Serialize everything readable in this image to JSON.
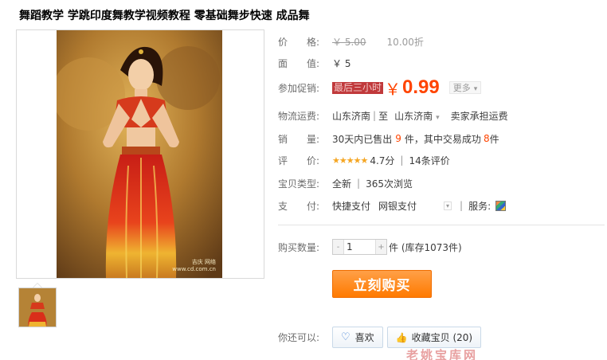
{
  "title": "舞蹈教学 学跳印度舞教学视频教程 零基础舞步快速 成品舞",
  "image": {
    "watermark_line1": "吉庆 网络",
    "watermark_line2": "www.cd.com.cn"
  },
  "price": {
    "label": "价　　格:",
    "original": "￥ 5.00",
    "discount": "10.00折"
  },
  "face_value": {
    "label": "面　　值:",
    "value": "￥ 5"
  },
  "promo": {
    "label": "参加促销:",
    "tag": "最后三小时",
    "currency": "￥",
    "price": "0.99",
    "more": "更多"
  },
  "shipping": {
    "label": "物流运费:",
    "from": "山东济南",
    "to_word": "至",
    "to": "山东济南",
    "fee": "卖家承担运费"
  },
  "sales": {
    "label": "销　　量:",
    "prefix": "30天内已售出",
    "sold": "9",
    "mid": "件，其中交易成功",
    "success": "8",
    "suffix": "件"
  },
  "rating": {
    "label": "评　　价:",
    "stars": "★★★★★",
    "score": "4.7分",
    "reviews": "14条评价"
  },
  "item_type": {
    "label": "宝贝类型:",
    "condition": "全新",
    "views": "365次浏览"
  },
  "payment": {
    "label": "支　　付:",
    "method1": "快捷支付",
    "method2": "网银支付",
    "service_label": "服务:"
  },
  "quantity": {
    "label": "购买数量:",
    "value": "1",
    "minus": "-",
    "plus": "+",
    "stock": "件 (库存1073件)"
  },
  "buy_button": "立刻购买",
  "also": {
    "label": "你还可以:",
    "like": "喜欢",
    "favorite": "收藏宝贝 (20)"
  },
  "bottom_text": "老姚宝库网"
}
